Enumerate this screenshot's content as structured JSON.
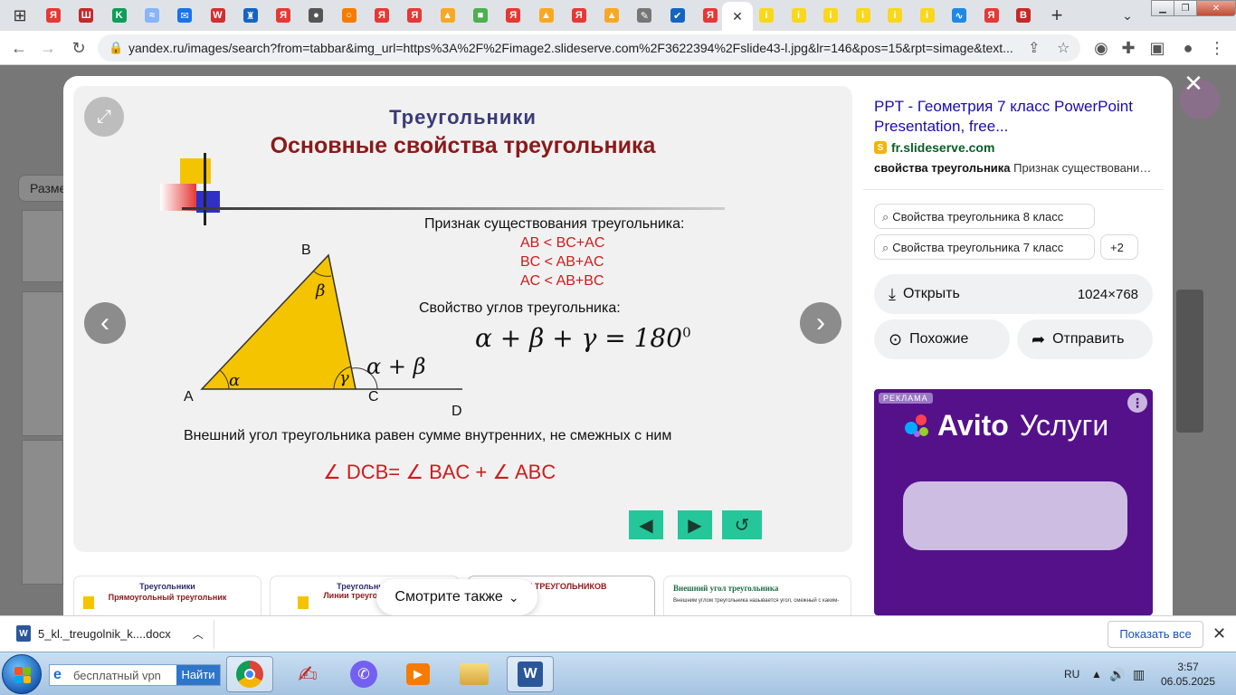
{
  "browser": {
    "tabs": [
      {
        "glyph": "Я",
        "color": "#e53935"
      },
      {
        "glyph": "Ш",
        "color": "#c62828"
      },
      {
        "glyph": "K",
        "color": "#0f9d58"
      },
      {
        "glyph": "≈",
        "color": "#8ab4f8"
      },
      {
        "glyph": "✉",
        "color": "#1a73e8"
      },
      {
        "glyph": "W",
        "color": "#d32f2f"
      },
      {
        "glyph": "♜",
        "color": "#1565c0"
      },
      {
        "glyph": "Я",
        "color": "#e53935"
      },
      {
        "glyph": "●",
        "color": "#555555"
      },
      {
        "glyph": "○",
        "color": "#f57c00"
      },
      {
        "glyph": "Я",
        "color": "#e53935"
      },
      {
        "glyph": "Я",
        "color": "#e53935"
      },
      {
        "glyph": "▲",
        "color": "#f9a825"
      },
      {
        "glyph": "■",
        "color": "#4caf50"
      },
      {
        "glyph": "Я",
        "color": "#e53935"
      },
      {
        "glyph": "▲",
        "color": "#f9a825"
      },
      {
        "glyph": "Я",
        "color": "#e53935"
      },
      {
        "glyph": "▲",
        "color": "#f9a825"
      },
      {
        "glyph": "✎",
        "color": "#777777"
      },
      {
        "glyph": "✔",
        "color": "#1565c0"
      },
      {
        "glyph": "Я",
        "color": "#e53935"
      }
    ],
    "tabs_after": [
      {
        "glyph": "i",
        "color": "#f9d71c"
      },
      {
        "glyph": "i",
        "color": "#f9d71c"
      },
      {
        "glyph": "i",
        "color": "#f9d71c"
      },
      {
        "glyph": "i",
        "color": "#f9d71c"
      },
      {
        "glyph": "i",
        "color": "#f9d71c"
      },
      {
        "glyph": "i",
        "color": "#f9d71c"
      },
      {
        "glyph": "∿",
        "color": "#1e88e5"
      },
      {
        "glyph": "Я",
        "color": "#e53935"
      },
      {
        "glyph": "B",
        "color": "#c62828"
      }
    ],
    "active_tab_close": "✕",
    "new_tab": "+",
    "url": "yandex.ru/images/search?from=tabbar&img_url=https%3A%2F%2Fimage2.slideserve.com%2F3622394%2Fslide43-l.jpg&lr=146&pos=15&rpt=simage&text..."
  },
  "modal": {
    "close": "✕",
    "slide": {
      "title1": "Треугольники",
      "title2": "Основные свойства треугольника",
      "existence_heading": "Признак существования треугольника:",
      "inequalities": [
        "AB < BC+AC",
        "BC < AB+AC",
        "AC < AB+BC"
      ],
      "angles_heading": "Свойство углов треугольника:",
      "formula": "α + β + γ = 180",
      "formula_sup": "0",
      "vertex_a": "A",
      "vertex_b": "B",
      "vertex_c": "C",
      "point_d": "D",
      "angle_alpha": "α",
      "angle_beta": "β",
      "angle_gamma": "γ",
      "exterior_angle": "α + β",
      "exterior_text": "Внешний угол треугольника равен сумме внутренних, не смежных с ним",
      "exterior_eq": "∠ DCB= ∠ BAC + ∠ ABC",
      "triangle_color": "#f5c400"
    },
    "thumbnails": [
      {
        "title": "Треугольники",
        "subtitle": "Прямоугольный треугольник"
      },
      {
        "title": "Треугольники",
        "subtitle": "Линии треугольника"
      },
      {
        "title": "ЧИЕ ТРЕУГОЛЬНИКОВ",
        "subtitle": ""
      },
      {
        "title": "Внешний угол треугольника",
        "subtitle": "Внешним углом треугольника называется угол, смежный с каким-"
      }
    ],
    "see_also": "Смотрите также",
    "side": {
      "title": "PPT - Геометрия 7 класс PowerPoint Presentation, free...",
      "domain": "fr.slideserve.com",
      "snippet_bold": "свойства треугольника",
      "snippet_rest": " Признак существования треугольника",
      "tags": [
        "Свойства треугольника 8 класс",
        "Свойства треугольника 7 класс",
        "+2"
      ],
      "open_label": "Открыть",
      "dimensions": "1024×768",
      "similar_label": "Похожие",
      "share_label": "Отправить"
    },
    "ad": {
      "badge": "РЕКЛАМА",
      "brand": "Avito",
      "brand_suffix": "Услуги",
      "bg_color": "#55118a"
    }
  },
  "background": {
    "chip": "Разме"
  },
  "downloads": {
    "file": "5_kl._treugolnik_k....docx",
    "show_all": "Показать все"
  },
  "taskbar": {
    "search_placeholder": "бесплатный vpn",
    "search_button": "Найти",
    "language": "RU",
    "time": "3:57",
    "date": "06.05.2025"
  }
}
